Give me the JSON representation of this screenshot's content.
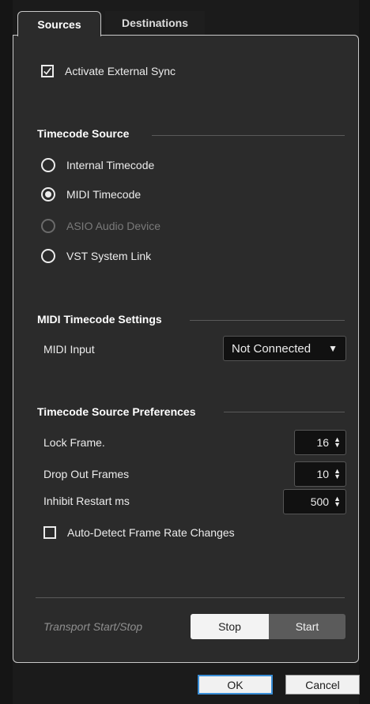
{
  "tabs": [
    {
      "label": "Sources",
      "active": true
    },
    {
      "label": "Destinations",
      "active": false
    }
  ],
  "activate_sync": {
    "label": "Activate External Sync",
    "checked": true
  },
  "timecode_source": {
    "title": "Timecode Source",
    "options": [
      {
        "label": "Internal Timecode",
        "selected": false,
        "enabled": true
      },
      {
        "label": "MIDI Timecode",
        "selected": true,
        "enabled": true
      },
      {
        "label": "ASIO Audio Device",
        "selected": false,
        "enabled": false
      },
      {
        "label": "VST System Link",
        "selected": false,
        "enabled": true
      }
    ]
  },
  "midi_settings": {
    "title": "MIDI Timecode Settings",
    "midi_input_label": "MIDI Input",
    "midi_input_value": "Not Connected"
  },
  "preferences": {
    "title": "Timecode Source Preferences",
    "lock_frame_label": "Lock Frame.",
    "lock_frame_value": "16",
    "drop_out_label": "Drop Out Frames",
    "drop_out_value": "10",
    "inhibit_label": "Inhibit Restart ms",
    "inhibit_value": "500",
    "auto_detect_label": "Auto-Detect Frame Rate Changes",
    "auto_detect_checked": false
  },
  "transport": {
    "label": "Transport Start/Stop",
    "stop_label": "Stop",
    "start_label": "Start"
  },
  "footer": {
    "ok_label": "OK",
    "cancel_label": "Cancel"
  },
  "icons": {
    "dropdown_arrow": "chevron-down-icon",
    "spinner": "spin-arrows-icon"
  }
}
